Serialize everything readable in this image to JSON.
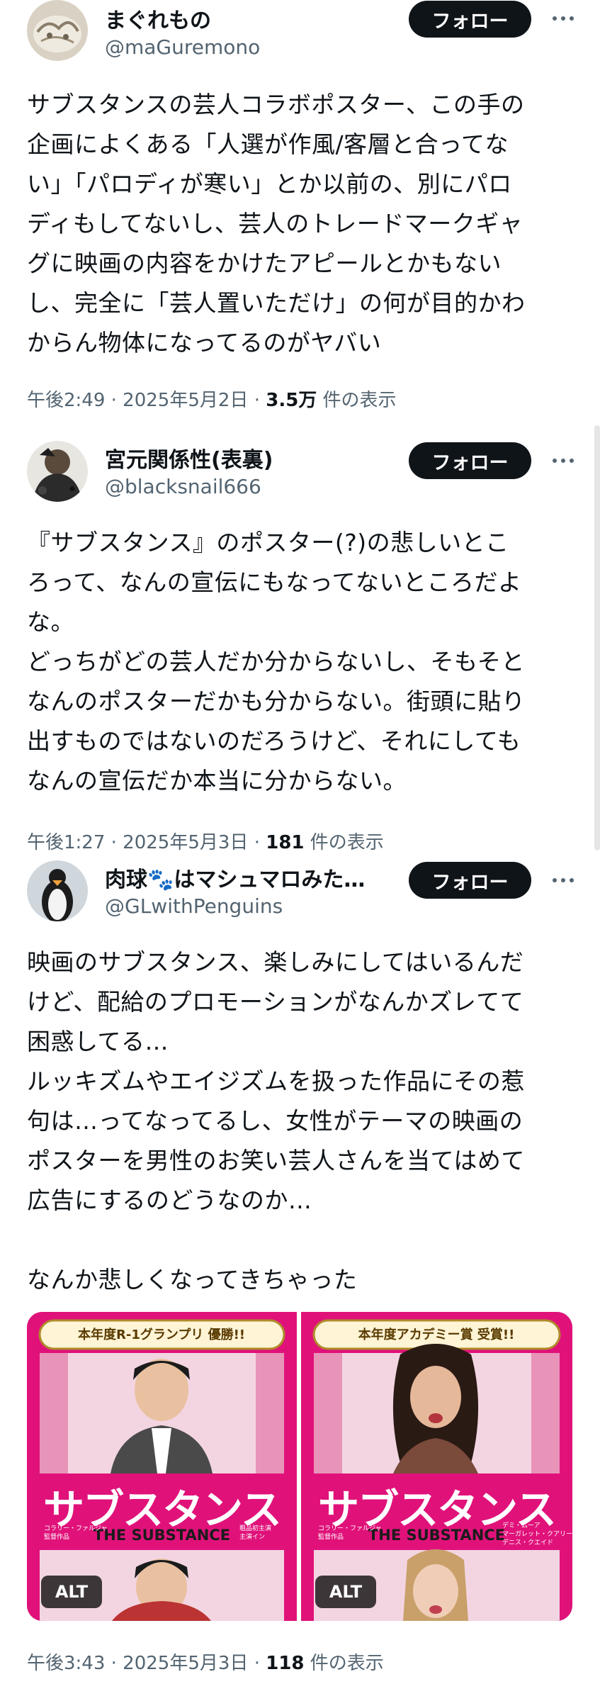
{
  "posts": [
    {
      "name": "まぐれもの",
      "handle": "@maGuremono",
      "follow_label": "フォロー",
      "text": "サブスタンスの芸人コラボポスター、この手の\n企画によくある「人選が作風/客層と合ってな\nい」「パロディが寒い」とか以前の、別にパロ\nディもしてないし、芸人のトレードマークギャ\nグに映画の内容をかけたアピールとかもない\nし、完全に「芸人置いただけ」の何が目的かわ\nからん物体になってるのがヤバい",
      "time": "午後2:49 · 2025年5月2日 · ",
      "views": "3.5万",
      "views_suffix": " 件の表示"
    },
    {
      "name": "宮元関係性(表裏)",
      "handle": "@blacksnail666",
      "follow_label": "フォロー",
      "text": "『サブスタンス』のポスター(?)の悲しいとこ\nろって、なんの宣伝にもなってないところだよ\nな。\nどっちがどの芸人だか分からないし、そもそと\nなんのポスターだかも分からない。街頭に貼り\n出すものではないのだろうけど、それにしても\nなんの宣伝だか本当に分からない。",
      "time": "午後1:27 · 2025年5月3日 · ",
      "views": "181",
      "views_suffix": " 件の表示"
    },
    {
      "name": "肉球🐾はマシュマロみた…",
      "handle": "@GLwithPenguins",
      "follow_label": "フォロー",
      "text": "映画のサブスタンス、楽しみにしてはいるんだ\nけど、配給のプロモーションがなんかズレてて\n困惑してる…\nルッキズムやエイジズムを扱った作品にその惹\n句は…ってなってるし、女性がテーマの映画の\nポスターを男性のお笑い芸人さんを当てはめて\n広告にするのどうなのか…\n\nなんか悲しくなってきちゃった",
      "time": "午後3:43 · 2025年5月3日 · ",
      "views": "118",
      "views_suffix": " 件の表示"
    }
  ],
  "posters": [
    {
      "banner": "本年度R-1グランプリ 優勝!!",
      "title": "サブスタンス",
      "subtitle": "THE SUBSTANCE",
      "credit_left": "コラリー・ファルジャ\n監督作品",
      "credit_right": "粗品初主演\n主演イン",
      "alt": "ALT",
      "accent": "#e0127a"
    },
    {
      "banner": "本年度アカデミー賞 受賞!!",
      "title": "サブスタンス",
      "subtitle": "THE SUBSTANCE",
      "credit_left": "コラリー・ファルジャ\n監督作品",
      "credit_right": "デミ・ムーア\nマーガレット・クアリー\nデニス・クエイド",
      "alt": "ALT",
      "accent": "#e0127a"
    }
  ],
  "icons": {
    "more": "more-horizontal-icon"
  }
}
